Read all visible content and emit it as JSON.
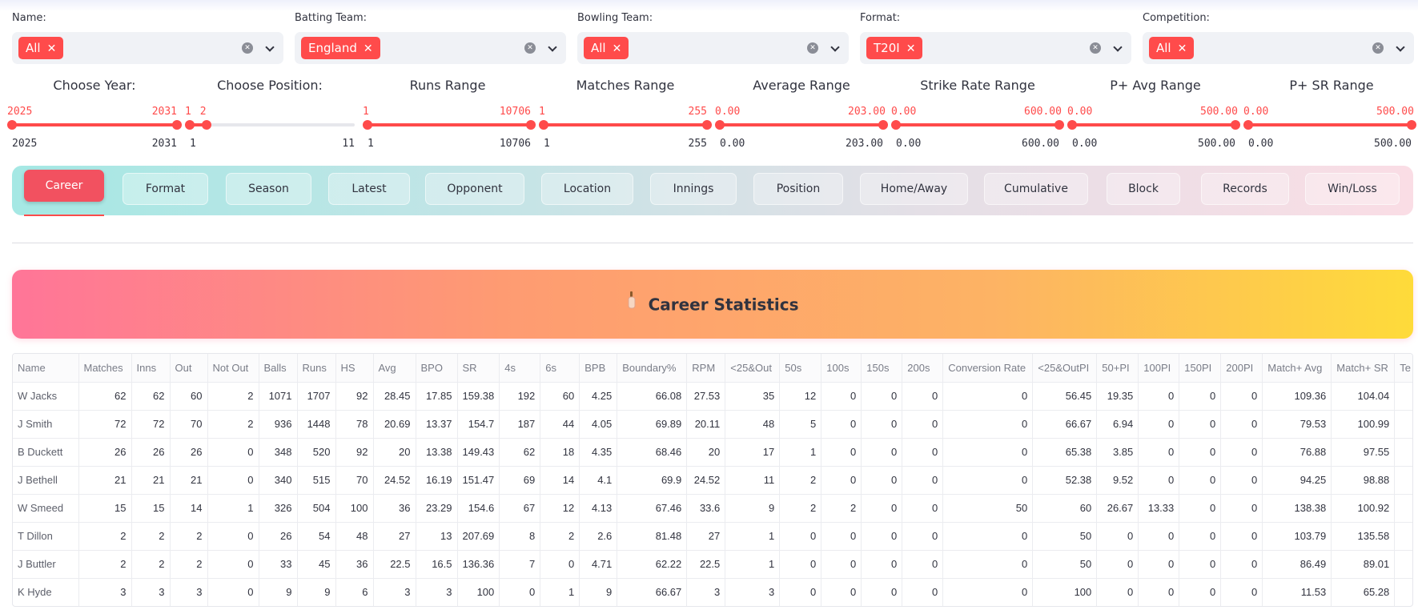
{
  "filters": [
    {
      "label": "Name:",
      "value": "All"
    },
    {
      "label": "Batting Team:",
      "value": "England"
    },
    {
      "label": "Bowling Team:",
      "value": "All"
    },
    {
      "label": "Format:",
      "value": "T20I"
    },
    {
      "label": "Competition:",
      "value": "All"
    }
  ],
  "sliders": [
    {
      "title": "Choose Year:",
      "sel_min": "2025",
      "sel_max": "2031",
      "min": "2025",
      "max": "2031",
      "lo": 0.0,
      "hi": 1.0
    },
    {
      "title": "Choose Position:",
      "sel_min": "1",
      "sel_max": "2",
      "min": "1",
      "max": "11",
      "lo": 0.0,
      "hi": 0.1
    },
    {
      "title": "Runs Range",
      "sel_min": "1",
      "sel_max": "10706",
      "min": "1",
      "max": "10706",
      "lo": 0.0,
      "hi": 1.0
    },
    {
      "title": "Matches Range",
      "sel_min": "1",
      "sel_max": "255",
      "min": "1",
      "max": "255",
      "lo": 0.0,
      "hi": 1.0
    },
    {
      "title": "Average Range",
      "sel_min": "0.00",
      "sel_max": "203.00",
      "min": "0.00",
      "max": "203.00",
      "lo": 0.0,
      "hi": 1.0
    },
    {
      "title": "Strike Rate Range",
      "sel_min": "0.00",
      "sel_max": "600.00",
      "min": "0.00",
      "max": "600.00",
      "lo": 0.0,
      "hi": 1.0
    },
    {
      "title": "P+ Avg Range",
      "sel_min": "0.00",
      "sel_max": "500.00",
      "min": "0.00",
      "max": "500.00",
      "lo": 0.0,
      "hi": 1.0
    },
    {
      "title": "P+ SR Range",
      "sel_min": "0.00",
      "sel_max": "500.00",
      "min": "0.00",
      "max": "500.00",
      "lo": 0.0,
      "hi": 1.0
    }
  ],
  "tabs": [
    "Career",
    "Format",
    "Season",
    "Latest",
    "Opponent",
    "Location",
    "Innings",
    "Position",
    "Home/Away",
    "Cumulative",
    "Block",
    "Records",
    "Win/Loss"
  ],
  "active_tab": "Career",
  "banner": {
    "icon": "cricket-bat-icon",
    "title": "Career Statistics"
  },
  "table": {
    "columns": [
      "Name",
      "Matches",
      "Inns",
      "Out",
      "Not Out",
      "Balls",
      "Runs",
      "HS",
      "Avg",
      "BPO",
      "SR",
      "4s",
      "6s",
      "BPB",
      "Boundary%",
      "RPM",
      "<25&Out",
      "50s",
      "100s",
      "150s",
      "200s",
      "Conversion Rate",
      "<25&OutPI",
      "50+PI",
      "100PI",
      "150PI",
      "200PI",
      "Match+ Avg",
      "Match+ SR",
      "Te"
    ],
    "rows": [
      [
        "W Jacks",
        "62",
        "62",
        "60",
        "2",
        "1071",
        "1707",
        "92",
        "28.45",
        "17.85",
        "159.38",
        "192",
        "60",
        "4.25",
        "66.08",
        "27.53",
        "35",
        "12",
        "0",
        "0",
        "0",
        "0",
        "56.45",
        "19.35",
        "0",
        "0",
        "0",
        "109.36",
        "104.04",
        ""
      ],
      [
        "J Smith",
        "72",
        "72",
        "70",
        "2",
        "936",
        "1448",
        "78",
        "20.69",
        "13.37",
        "154.7",
        "187",
        "44",
        "4.05",
        "69.89",
        "20.11",
        "48",
        "5",
        "0",
        "0",
        "0",
        "0",
        "66.67",
        "6.94",
        "0",
        "0",
        "0",
        "79.53",
        "100.99",
        ""
      ],
      [
        "B Duckett",
        "26",
        "26",
        "26",
        "0",
        "348",
        "520",
        "92",
        "20",
        "13.38",
        "149.43",
        "62",
        "18",
        "4.35",
        "68.46",
        "20",
        "17",
        "1",
        "0",
        "0",
        "0",
        "0",
        "65.38",
        "3.85",
        "0",
        "0",
        "0",
        "76.88",
        "97.55",
        ""
      ],
      [
        "J Bethell",
        "21",
        "21",
        "21",
        "0",
        "340",
        "515",
        "70",
        "24.52",
        "16.19",
        "151.47",
        "69",
        "14",
        "4.1",
        "69.9",
        "24.52",
        "11",
        "2",
        "0",
        "0",
        "0",
        "0",
        "52.38",
        "9.52",
        "0",
        "0",
        "0",
        "94.25",
        "98.88",
        ""
      ],
      [
        "W Smeed",
        "15",
        "15",
        "14",
        "1",
        "326",
        "504",
        "100",
        "36",
        "23.29",
        "154.6",
        "67",
        "12",
        "4.13",
        "67.46",
        "33.6",
        "9",
        "2",
        "2",
        "0",
        "0",
        "50",
        "60",
        "26.67",
        "13.33",
        "0",
        "0",
        "138.38",
        "100.92",
        ""
      ],
      [
        "T Dillon",
        "2",
        "2",
        "2",
        "0",
        "26",
        "54",
        "48",
        "27",
        "13",
        "207.69",
        "8",
        "2",
        "2.6",
        "81.48",
        "27",
        "1",
        "0",
        "0",
        "0",
        "0",
        "0",
        "50",
        "0",
        "0",
        "0",
        "0",
        "103.79",
        "135.58",
        ""
      ],
      [
        "J Buttler",
        "2",
        "2",
        "2",
        "0",
        "33",
        "45",
        "36",
        "22.5",
        "16.5",
        "136.36",
        "7",
        "0",
        "4.71",
        "62.22",
        "22.5",
        "1",
        "0",
        "0",
        "0",
        "0",
        "0",
        "50",
        "0",
        "0",
        "0",
        "0",
        "86.49",
        "89.01",
        ""
      ],
      [
        "K Hyde",
        "3",
        "3",
        "3",
        "0",
        "9",
        "9",
        "6",
        "3",
        "3",
        "100",
        "0",
        "1",
        "9",
        "66.67",
        "3",
        "3",
        "0",
        "0",
        "0",
        "0",
        "0",
        "100",
        "0",
        "0",
        "0",
        "0",
        "11.53",
        "65.28",
        ""
      ]
    ]
  }
}
